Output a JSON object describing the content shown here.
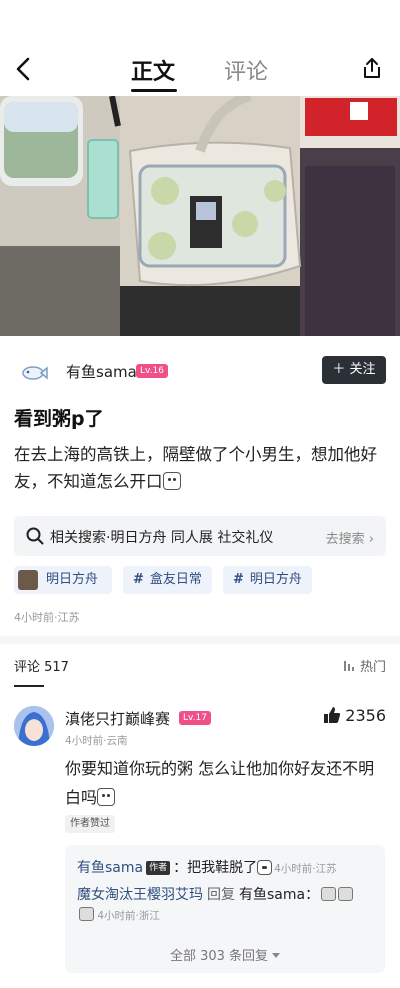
{
  "nav": {
    "tab_main": "正文",
    "tab_comments": "评论"
  },
  "author": {
    "name": "有鱼sama",
    "level": "Lv.16",
    "follow_label": "＋ 关注"
  },
  "post": {
    "title": "看到粥p了",
    "body": "在去上海的高铁上，隔壁做了个小男生，想加他好友，不知道怎么开口",
    "related_search": "相关搜索·明日方舟 同人展 社交礼仪",
    "search_go": "去搜索 ›",
    "tags": {
      "topic": "明日方舟",
      "hashtag1": "盒友日常",
      "hashtag2": "明日方舟"
    },
    "meta": "4小时前·江苏"
  },
  "comments": {
    "count_label": "评论 517",
    "sort_label": "热门",
    "top": {
      "name": "滇佬只打巅峰赛",
      "level": "Lv.17",
      "likes": "2356",
      "meta": "4小时前·云南",
      "body": "你要知道你玩的粥 怎么让他加你好友还不明白吗",
      "badge": "作者赞过",
      "replies": {
        "r1_name": "有鱼sama",
        "r1_author_tag": "作者",
        "r1_text": "：把我鞋脱了",
        "r1_meta": "4小时前·江苏",
        "r2_name": "魔女淘汰王樱羽艾玛",
        "r2_reply_word": "回复",
        "r2_target": "有鱼sama：",
        "r3_meta": "4小时前·浙江",
        "all_label": "全部 303 条回复"
      }
    }
  }
}
